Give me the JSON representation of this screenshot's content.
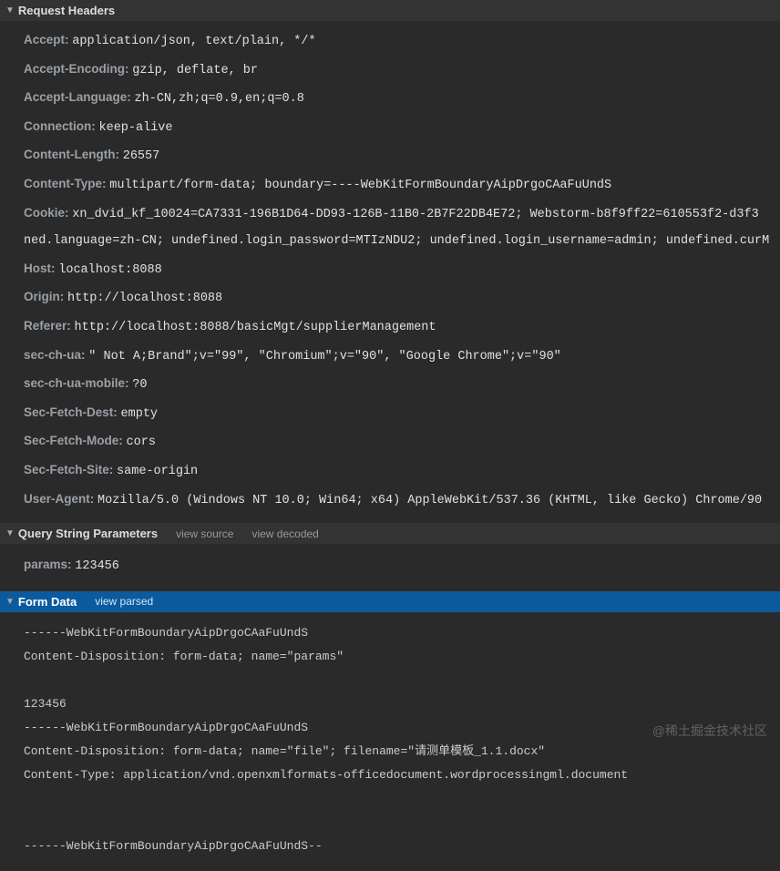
{
  "sections": {
    "requestHeaders": {
      "title": "Request Headers",
      "items": [
        {
          "name": "Accept:",
          "value": "application/json, text/plain, */*"
        },
        {
          "name": "Accept-Encoding:",
          "value": "gzip, deflate, br"
        },
        {
          "name": "Accept-Language:",
          "value": "zh-CN,zh;q=0.9,en;q=0.8"
        },
        {
          "name": "Connection:",
          "value": "keep-alive"
        },
        {
          "name": "Content-Length:",
          "value": "26557"
        },
        {
          "name": "Content-Type:",
          "value": "multipart/form-data; boundary=----WebKitFormBoundaryAipDrgoCAaFuUndS"
        },
        {
          "name": "Cookie:",
          "value": "xn_dvid_kf_10024=CA7331-196B1D64-DD93-126B-11B0-2B7F22DB4E72; Webstorm-b8f9ff22=610553f2-d3f3"
        },
        {
          "name": "",
          "value": "ned.language=zh-CN; undefined.login_password=MTIzNDU2; undefined.login_username=admin; undefined.curM"
        },
        {
          "name": "Host:",
          "value": "localhost:8088"
        },
        {
          "name": "Origin:",
          "value": "http://localhost:8088"
        },
        {
          "name": "Referer:",
          "value": "http://localhost:8088/basicMgt/supplierManagement"
        },
        {
          "name": "sec-ch-ua:",
          "value": "\" Not A;Brand\";v=\"99\", \"Chromium\";v=\"90\", \"Google Chrome\";v=\"90\""
        },
        {
          "name": "sec-ch-ua-mobile:",
          "value": "?0"
        },
        {
          "name": "Sec-Fetch-Dest:",
          "value": "empty"
        },
        {
          "name": "Sec-Fetch-Mode:",
          "value": "cors"
        },
        {
          "name": "Sec-Fetch-Site:",
          "value": "same-origin"
        },
        {
          "name": "User-Agent:",
          "value": "Mozilla/5.0 (Windows NT 10.0; Win64; x64) AppleWebKit/537.36 (KHTML, like Gecko) Chrome/90"
        }
      ]
    },
    "queryString": {
      "title": "Query String Parameters",
      "viewSource": "view source",
      "viewDecoded": "view decoded",
      "items": [
        {
          "name": "params:",
          "value": "123456"
        }
      ]
    },
    "formData": {
      "title": "Form Data",
      "viewParsed": "view parsed",
      "lines": [
        "------WebKitFormBoundaryAipDrgoCAaFuUndS",
        "Content-Disposition: form-data; name=\"params\"",
        "",
        "123456",
        "------WebKitFormBoundaryAipDrgoCAaFuUndS",
        "Content-Disposition: form-data; name=\"file\"; filename=\"请测单模板_1.1.docx\"",
        "Content-Type: application/vnd.openxmlformats-officedocument.wordprocessingml.document",
        "",
        "",
        "------WebKitFormBoundaryAipDrgoCAaFuUndS--"
      ]
    }
  },
  "watermark": "@稀土掘金技术社区"
}
